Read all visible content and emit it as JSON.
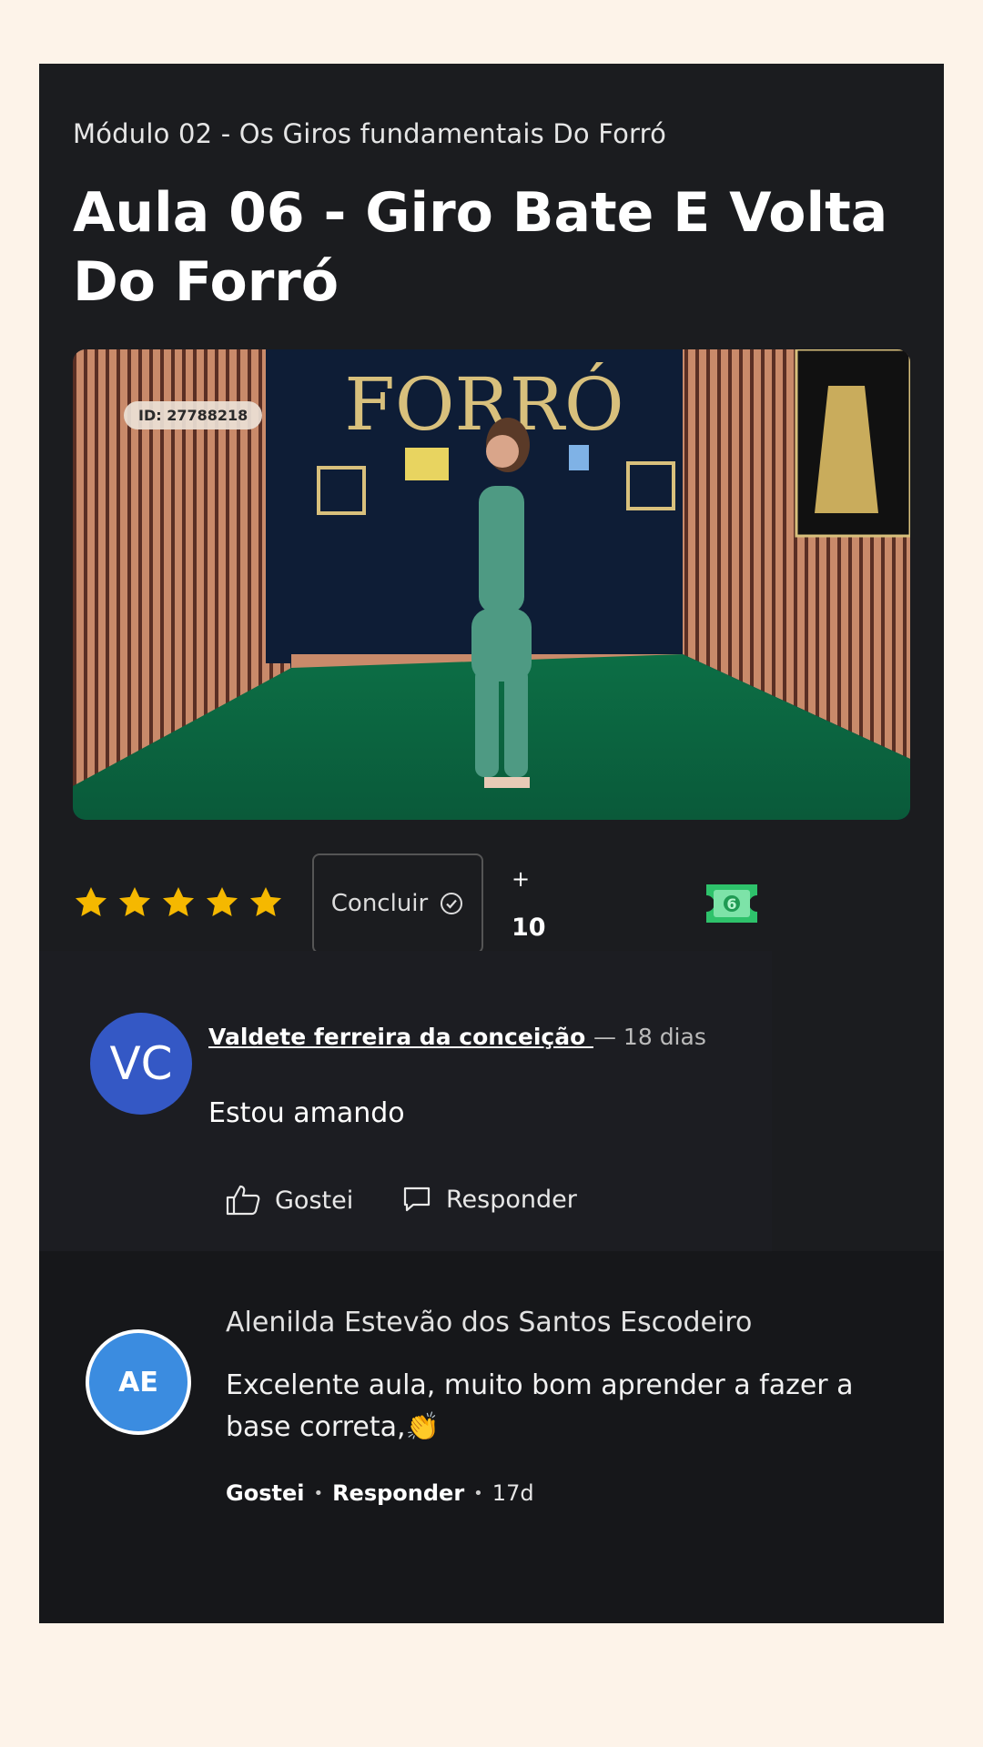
{
  "lesson": {
    "module": "Módulo 02 - Os Giros fundamentais Do Forró",
    "title": "Aula 06 - Giro Bate E Volta Do Forró"
  },
  "video": {
    "id_badge": "ID: 27788218",
    "sign": "FORRÓ"
  },
  "actions": {
    "rating": 5,
    "rating_max": 5,
    "complete_label": "Concluir",
    "points_prefix": "+",
    "points": "10",
    "star_color": "#f5b800",
    "ticket_color": "#2ec26b"
  },
  "comments": [
    {
      "avatar_initials": "VC",
      "author": "Valdete ferreira da conceição ",
      "time_ago": "— 18 dias",
      "text": "Estou amando",
      "like_label": "Gostei",
      "reply_label": "Responder",
      "avatar_color": "#3458c5"
    },
    {
      "avatar_initials": "AE",
      "author": "Alenilda Estevão dos Santos Escodeiro",
      "text": "Excelente aula, muito bom aprender a fazer a base correta,👏",
      "like_label": "Gostei",
      "reply_label": "Responder",
      "time_ago": "17d",
      "avatar_color": "#3b8ce0"
    }
  ]
}
